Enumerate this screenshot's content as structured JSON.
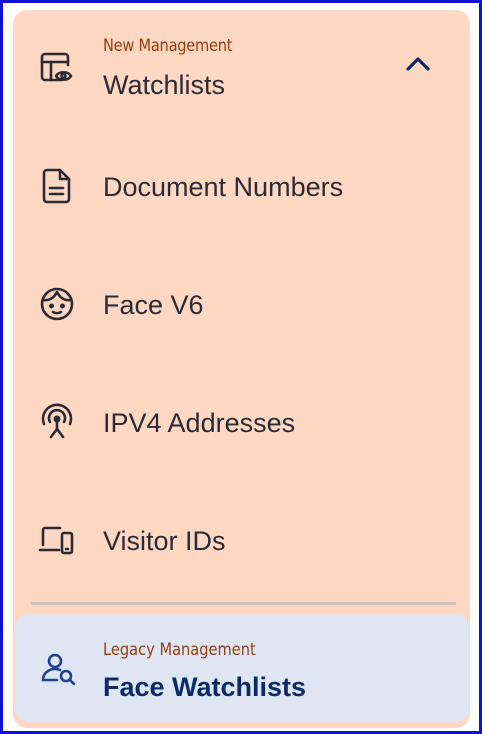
{
  "colors": {
    "panel_bg": "#fed8c3",
    "active_bg": "#dfe6f3",
    "eyebrow_text": "#9a3c0c",
    "item_text": "#2b2b35",
    "active_text": "#0e2a66",
    "icon_active": "#1f3f8f",
    "frame_border": "#1010d8"
  },
  "new_management": {
    "eyebrow": "New Management",
    "title": "Watchlists",
    "title_icon": "watchlist-eye-icon",
    "expand_icon": "chevron-up-icon",
    "expanded": true,
    "items": [
      {
        "label": "Document Numbers",
        "icon": "document-icon"
      },
      {
        "label": "Face V6",
        "icon": "face-icon"
      },
      {
        "label": "IPV4 Addresses",
        "icon": "broadcast-antenna-icon"
      },
      {
        "label": "Visitor IDs",
        "icon": "devices-icon"
      }
    ]
  },
  "legacy_management": {
    "eyebrow": "Legacy Management",
    "title": "Face Watchlists",
    "icon": "user-search-icon",
    "active": true
  }
}
